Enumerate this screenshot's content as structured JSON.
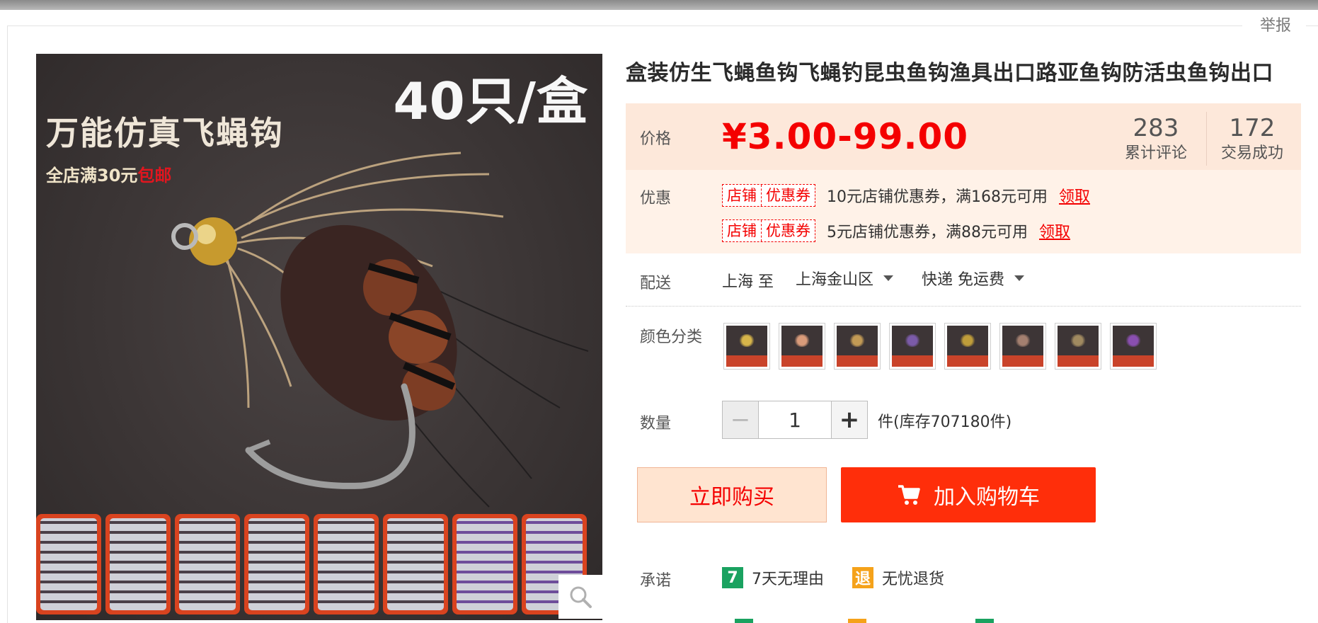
{
  "header": {
    "report_label": "举报"
  },
  "image": {
    "count_text": "40只/盒",
    "headline": "万能仿真飞蝇钩",
    "subline_main": "全店满30元",
    "subline_highlight": "包邮",
    "zoom_icon": "search-icon"
  },
  "product": {
    "title": "盒装仿生飞蝇鱼钩飞蝇钓昆虫鱼钩渔具出口路亚鱼钩防活虫鱼钩出口"
  },
  "price": {
    "label": "价格",
    "value": "¥3.00-99.00",
    "reviews_count": "283",
    "reviews_label": "累计评论",
    "deals_count": "172",
    "deals_label": "交易成功"
  },
  "promo": {
    "label": "优惠",
    "coupons": [
      {
        "tag_left": "店铺",
        "tag_right": "优惠券",
        "text": "10元店铺优惠券，满168元可用",
        "action": "领取"
      },
      {
        "tag_left": "店铺",
        "tag_right": "优惠券",
        "text": "5元店铺优惠券，满88元可用",
        "action": "领取"
      }
    ]
  },
  "shipping": {
    "label": "配送",
    "from": "上海 至",
    "to": "上海金山区",
    "method": "快递 免运费"
  },
  "color": {
    "label": "颜色分类",
    "swatches": [
      "#d7b54a",
      "#d99b7a",
      "#c29a55",
      "#7b5ba8",
      "#bf9d3a",
      "#a48070",
      "#a08a60",
      "#8a4fb0"
    ]
  },
  "quantity": {
    "label": "数量",
    "minus": "−",
    "value": "1",
    "plus": "+",
    "stock_text": "件(库存707180件)"
  },
  "actions": {
    "buy_now": "立即购买",
    "add_to_cart": "加入购物车",
    "cart_icon": "cart-icon"
  },
  "promise": {
    "label": "承诺",
    "items": [
      {
        "badge": "7",
        "text": "7天无理由",
        "color": "#1aa260"
      },
      {
        "badge": "退",
        "text": "无忧退货",
        "color": "#f5a21a"
      }
    ]
  },
  "colors": {
    "accent": "#f40000",
    "cart_button": "#ff2e0a",
    "price_bg": "#fde8da",
    "promo_bg": "#fff2e8"
  }
}
